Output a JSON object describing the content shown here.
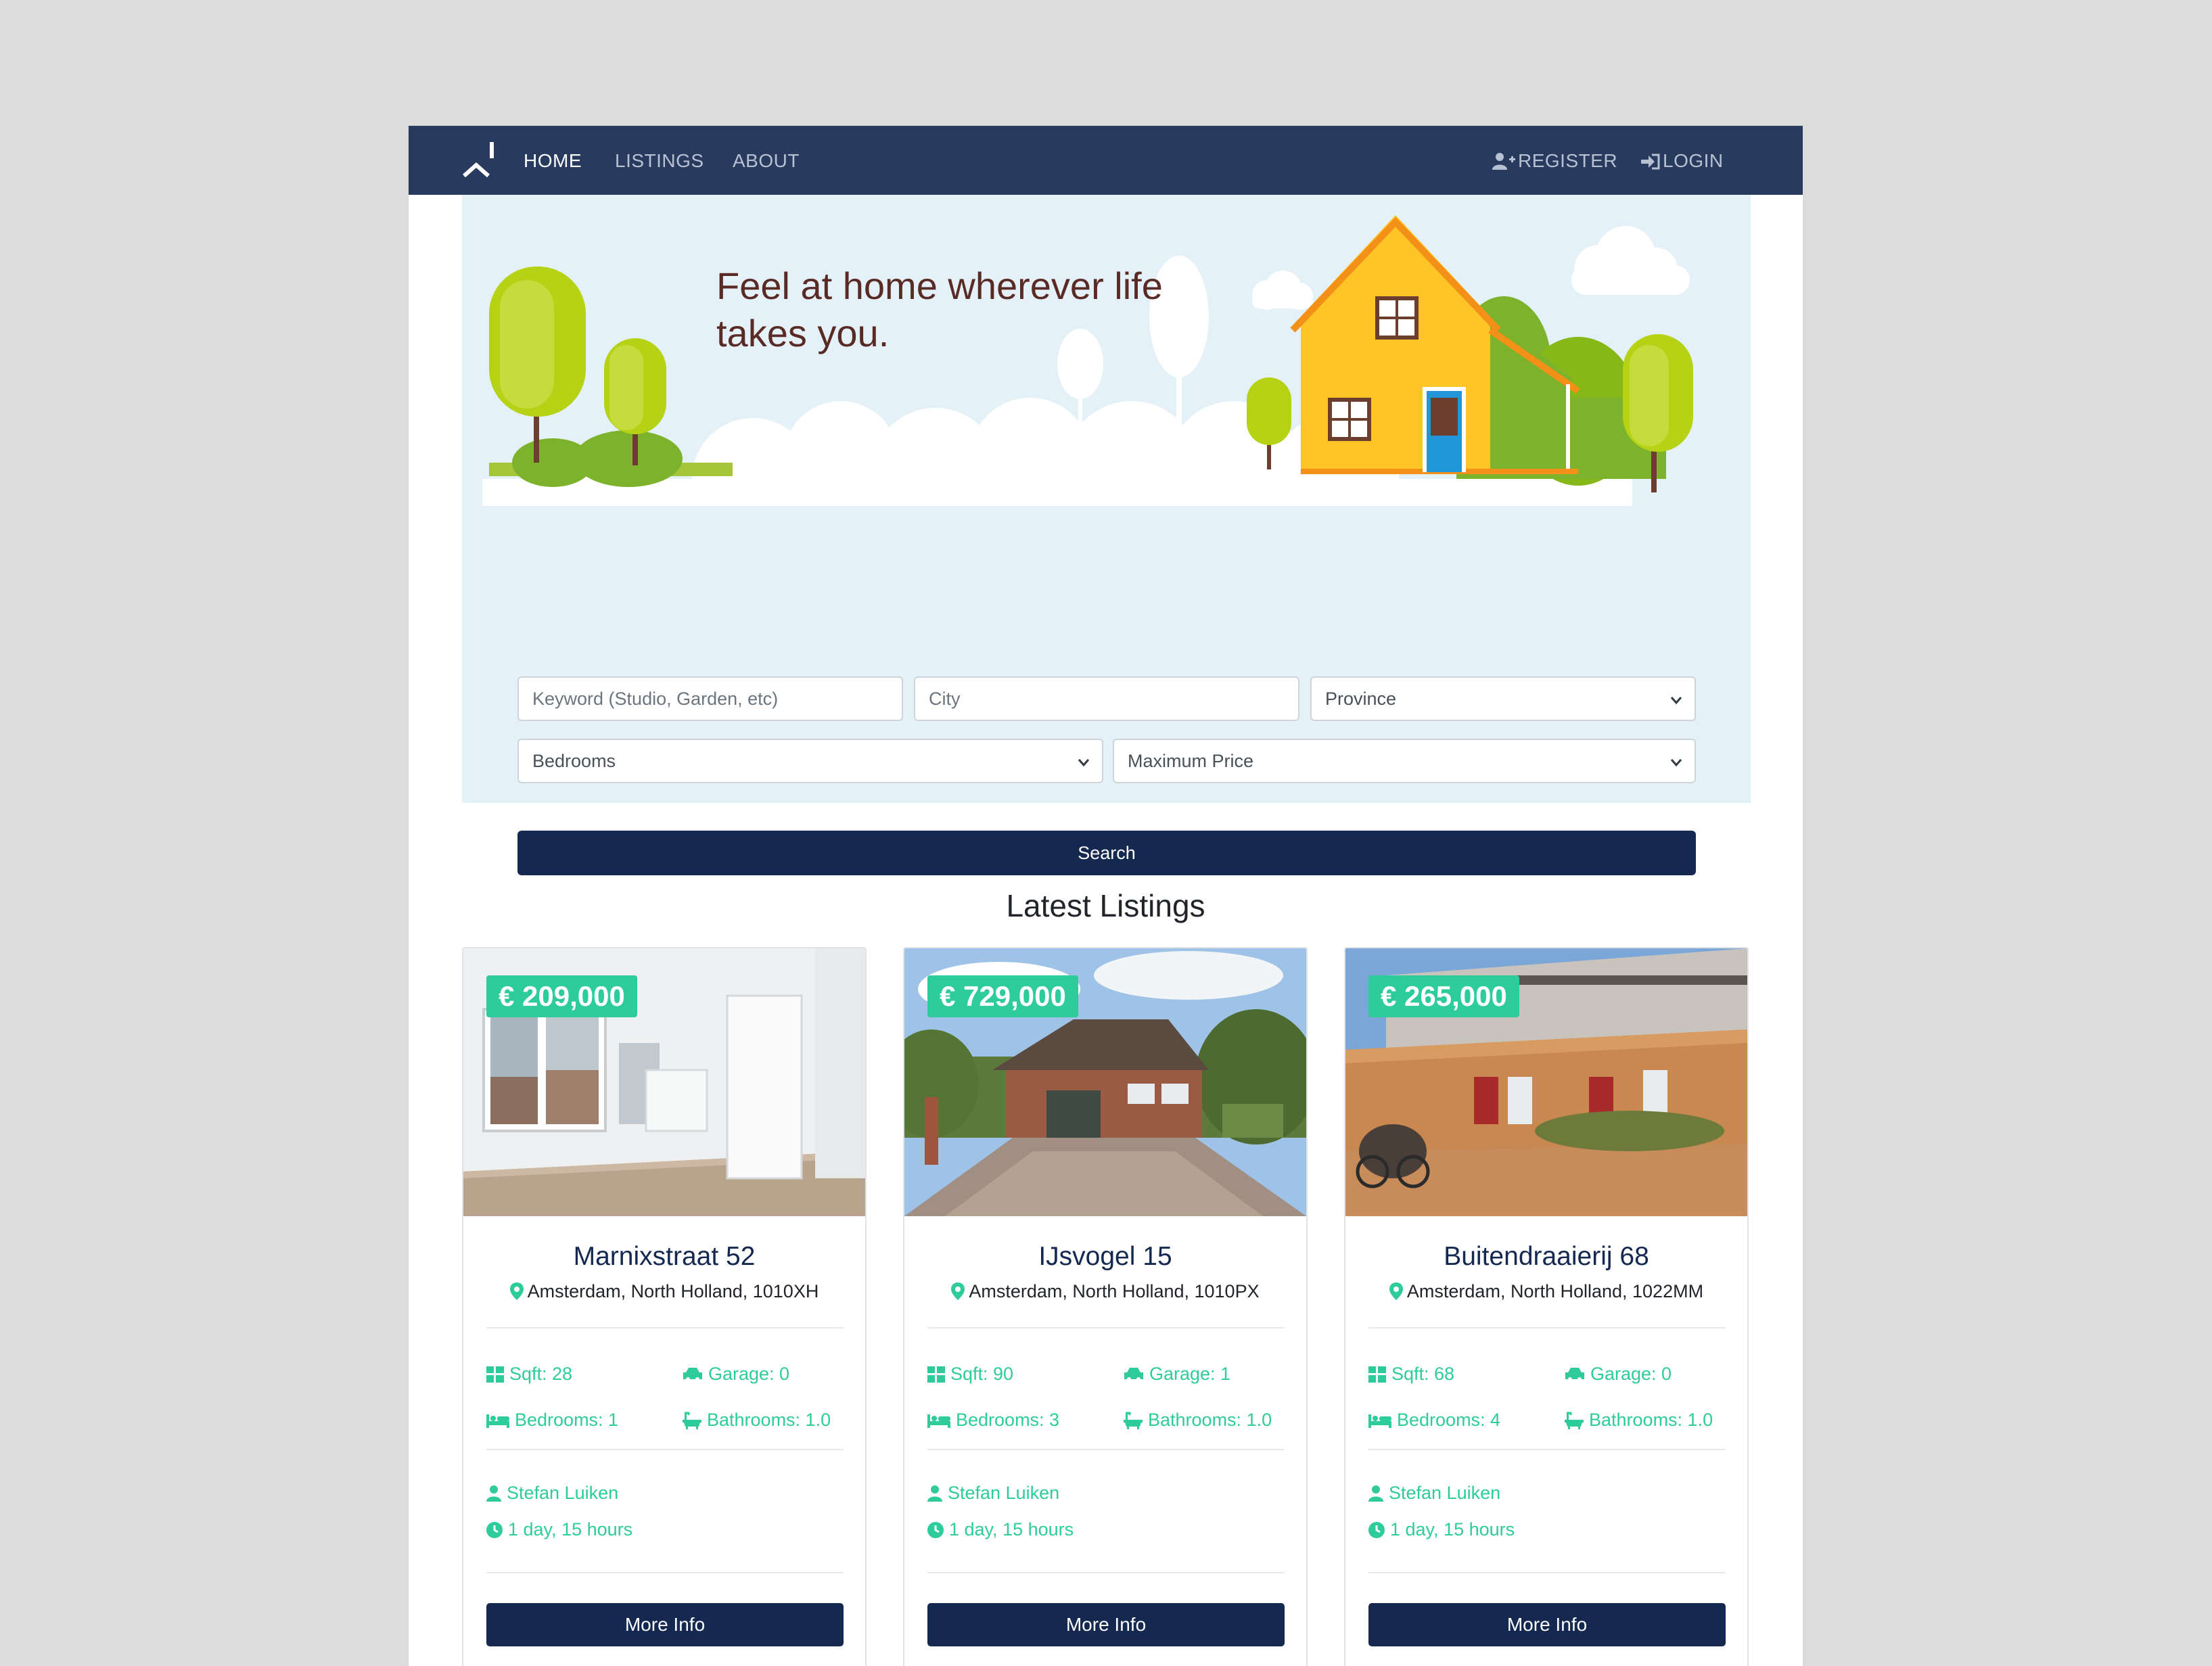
{
  "nav": {
    "links": [
      "HOME",
      "LISTINGS",
      "ABOUT"
    ],
    "register": "REGISTER",
    "login": "LOGIN"
  },
  "hero": {
    "title": "Feel at home wherever life takes you."
  },
  "search": {
    "keyword_placeholder": "Keyword (Studio, Garden, etc)",
    "city_placeholder": "City",
    "province_selected": "Province",
    "bedrooms_selected": "Bedrooms",
    "max_price_selected": "Maximum Price",
    "button_label": "Search"
  },
  "listings": {
    "heading": "Latest Listings",
    "cards": [
      {
        "price": "€ 209,000",
        "title": "Marnixstraat 52",
        "address": "Amsterdam, North Holland, 1010XH",
        "sqft": "Sqft: 28",
        "garage": "Garage: 0",
        "bedrooms": "Bedrooms: 1",
        "bathrooms": "Bathrooms: 1.0",
        "realtor": "Stefan Luiken",
        "listed": "1 day, 15 hours",
        "button": "More Info"
      },
      {
        "price": "€ 729,000",
        "title": "IJsvogel 15",
        "address": "Amsterdam, North Holland, 1010PX",
        "sqft": "Sqft: 90",
        "garage": "Garage: 1",
        "bedrooms": "Bedrooms: 3",
        "bathrooms": "Bathrooms: 1.0",
        "realtor": "Stefan Luiken",
        "listed": "1 day, 15 hours",
        "button": "More Info"
      },
      {
        "price": "€ 265,000",
        "title": "Buitendraaierij 68",
        "address": "Amsterdam, North Holland, 1022MM",
        "sqft": "Sqft: 68",
        "garage": "Garage: 0",
        "bedrooms": "Bedrooms: 4",
        "bathrooms": "Bathrooms: 1.0",
        "realtor": "Stefan Luiken",
        "listed": "1 day, 15 hours",
        "button": "More Info"
      }
    ]
  },
  "colors": {
    "navbar": "#283a5e",
    "primary_button": "#142850",
    "accent_green": "#2ecc9a",
    "hero_background": "#e5f1f8",
    "page_background": "#dcdcdc"
  }
}
